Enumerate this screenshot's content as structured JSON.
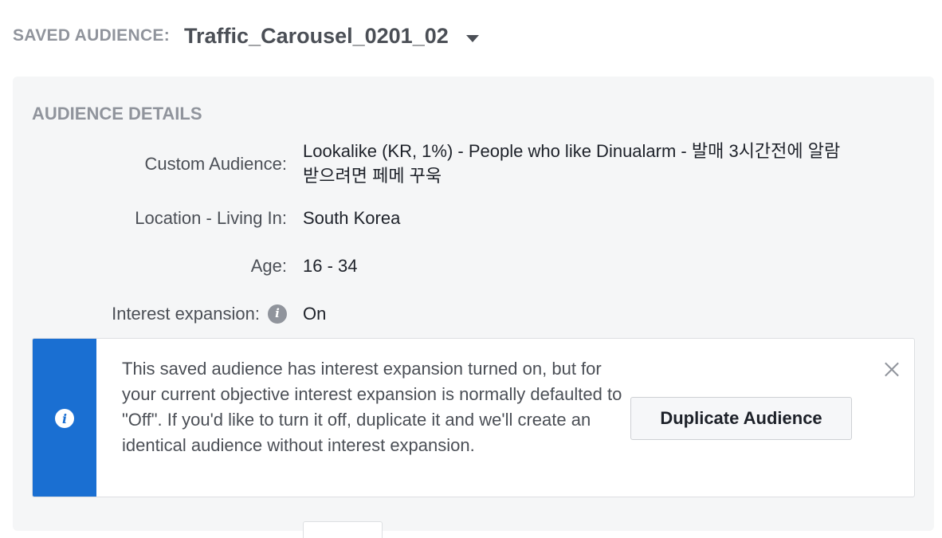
{
  "header": {
    "label": "SAVED AUDIENCE:",
    "audience_name": "Traffic_Carousel_0201_02",
    "dropdown_icon": "caret-down-icon"
  },
  "details": {
    "title": "AUDIENCE DETAILS",
    "rows": [
      {
        "key": "Custom Audience:",
        "value_line1": "Lookalike (KR, 1%) - People who like Dinualarm - 발매 3시간전에 알람",
        "value_line2": "받으려면 페메 꾸욱"
      },
      {
        "key": "Location - Living In:",
        "value": "South Korea"
      },
      {
        "key": "Age:",
        "value": "16 - 34"
      },
      {
        "key": "Interest expansion:",
        "value": "On",
        "icon": "info-icon"
      }
    ]
  },
  "notice": {
    "icon": "info-icon",
    "message": "This saved audience has interest expansion turned on, but for your current objective interest expansion is normally defaulted to \"Off\". If you'd like to turn it off, duplicate it and we'll create an identical audience without interest expansion.",
    "button_label": "Duplicate Audience",
    "close_icon": "close-icon",
    "accent_color": "#1a6fd2"
  }
}
